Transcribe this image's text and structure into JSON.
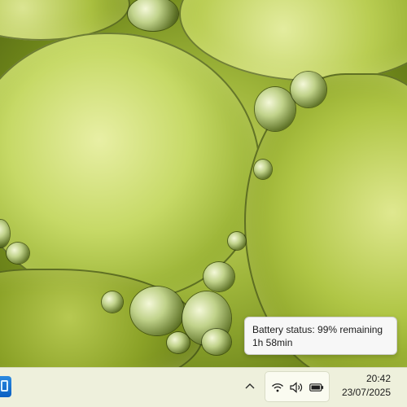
{
  "tooltip": {
    "line1": "Battery status: 99% remaining",
    "line2": "1h 58min"
  },
  "taskbar": {
    "clock": {
      "time": "20:42",
      "date": "23/07/2025"
    },
    "tray_icons": [
      "chevron-up-icon",
      "wifi-icon",
      "speaker-icon",
      "battery-icon"
    ],
    "start_icon": "windows-icon"
  },
  "colors": {
    "taskbar_bg": "#eef0dc",
    "tooltip_bg": "#f7f7f7",
    "start_accent": "#0a5fc2"
  }
}
